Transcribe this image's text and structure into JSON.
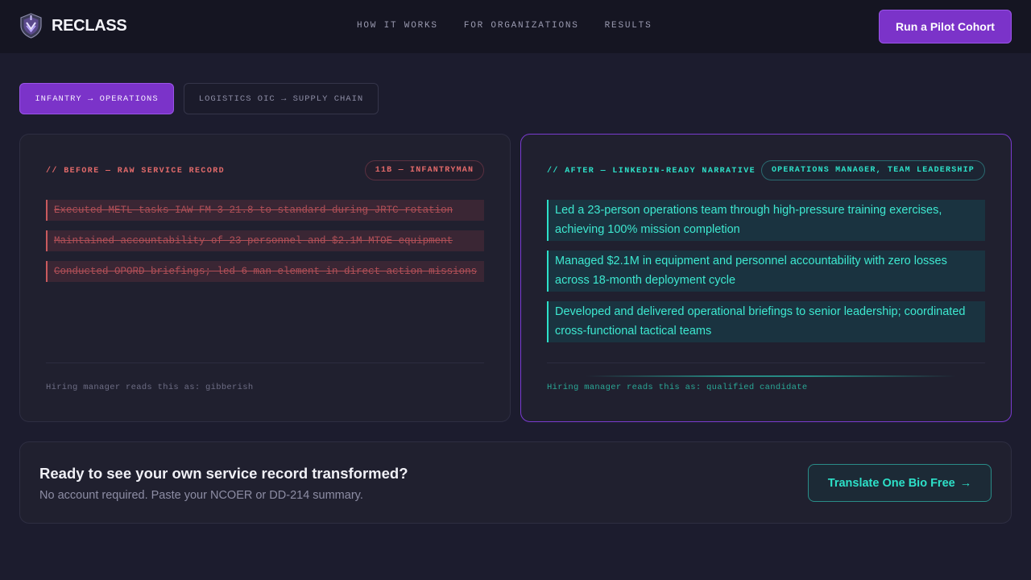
{
  "header": {
    "brand": "RECLASS",
    "nav": [
      "HOW IT WORKS",
      "FOR ORGANIZATIONS",
      "RESULTS"
    ],
    "cta_label": "Run a Pilot Cohort"
  },
  "tabs": [
    {
      "label": "INFANTRY → OPERATIONS",
      "active": true
    },
    {
      "label": "LOGISTICS OIC → SUPPLY CHAIN",
      "active": false
    }
  ],
  "before": {
    "label": "// BEFORE — RAW SERVICE RECORD",
    "badge": "11B — INFANTRYMAN",
    "lines": [
      "Executed METL tasks IAW FM 3-21.8 to standard during JRTC rotation",
      "Maintained accountability of 23 personnel and $2.1M MTOE equipment",
      "Conducted OPORD briefings; led 6-man element in direct action missions"
    ],
    "verdict": "Hiring manager reads this as: gibberish"
  },
  "after": {
    "label": "// AFTER — LINKEDIN-READY NARRATIVE",
    "badge": "OPERATIONS MANAGER, TEAM LEADERSHIP",
    "lines": [
      "Led a 23-person operations team through high-pressure training exercises, achieving 100% mission completion",
      "Managed $2.1M in equipment and personnel accountability with zero losses across 18-month deployment cycle",
      "Developed and delivered operational briefings to senior leadership; coordinated cross-functional tactical teams"
    ],
    "verdict": "Hiring manager reads this as: qualified candidate"
  },
  "cta": {
    "title": "Ready to see your own service record transformed?",
    "subtitle": "No account required. Paste your NCOER or DD-214 summary.",
    "button": "Translate One Bio Free",
    "button_arrow": "→"
  },
  "colors": {
    "accent_purple": "#7b33c9",
    "accent_teal": "#2de0c8",
    "danger_red": "#e26a6a",
    "background": "#1c1c2e"
  },
  "icons": {
    "logo": "shield-crest-icon"
  }
}
